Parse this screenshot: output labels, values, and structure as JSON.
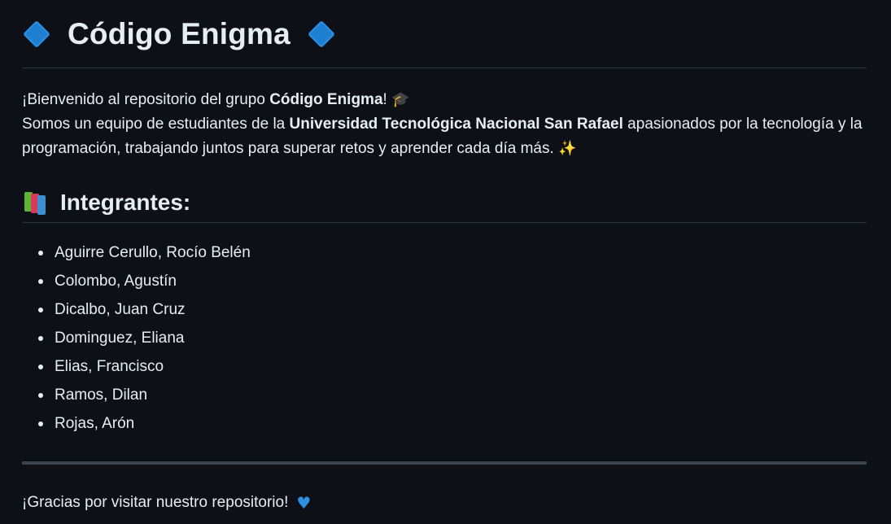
{
  "title": {
    "text": "Código Enigma",
    "left_icon": "blue-diamond-icon",
    "right_icon": "blue-diamond-icon",
    "icon_color": "#1f7fd1"
  },
  "intro": {
    "line1_pre": "¡Bienvenido al repositorio del grupo ",
    "line1_bold": "Código Enigma",
    "line1_post": "!",
    "line1_icon": "graduation-cap-icon",
    "line2_pre": "Somos un equipo de estudiantes de la ",
    "line2_bold": "Universidad Tecnológica Nacional San Rafael",
    "line2_post": " apasionados por la tecnología y la programación, trabajando juntos para superar retos y aprender cada día más.",
    "line2_icon": "sparkles-icon"
  },
  "members_section": {
    "heading": "Integrantes:",
    "icon": "books-icon",
    "members": [
      "Aguirre Cerullo, Rocío Belén",
      "Colombo, Agustín",
      "Dicalbo, Juan Cruz",
      "Dominguez, Eliana",
      "Elias, Francisco",
      "Ramos, Dilan",
      "Rojas, Arón"
    ]
  },
  "footer": {
    "text": "¡Gracias por visitar nuestro repositorio!",
    "icon": "blue-heart-icon"
  },
  "colors": {
    "background": "#0d1117",
    "text": "#e6edf3",
    "border": "#30363d",
    "accent_blue": "#2f8fe0"
  }
}
